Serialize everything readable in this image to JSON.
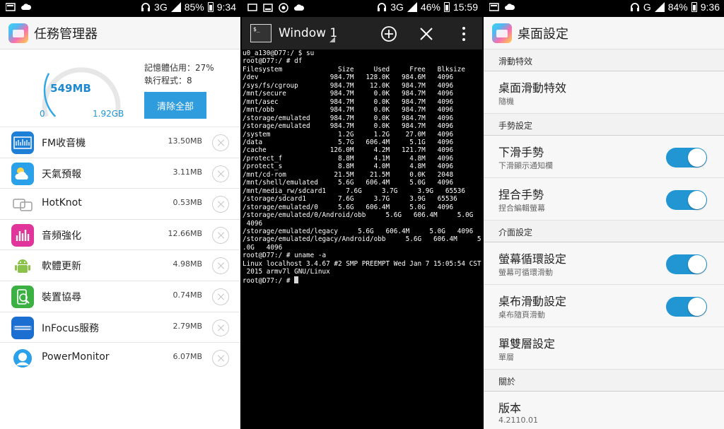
{
  "screens": {
    "task_manager": {
      "status": {
        "network": "3G",
        "battery": "85%",
        "time": "9:34"
      },
      "title": "任務管理器",
      "gauge": {
        "used": "549MB",
        "min": "0",
        "max": "1.92GB",
        "fraction": 0.27
      },
      "memory_usage": "記憶體佔用：27%",
      "running_programs": "執行程式：8",
      "clear_all_label": "清除全部",
      "apps": [
        {
          "name": "FM收音機",
          "size": "13.50MB",
          "icon": "radio-icon",
          "color": "#1e7fd6"
        },
        {
          "name": "天氣預報",
          "size": "3.11MB",
          "icon": "weather-icon",
          "color": "#2aa1e8"
        },
        {
          "name": "HotKnot",
          "size": "0.53MB",
          "icon": "hotknot-icon",
          "color": "#ffffff"
        },
        {
          "name": "音頻強化",
          "size": "12.66MB",
          "icon": "audio-enhance-icon",
          "color": "#e0359a"
        },
        {
          "name": "軟體更新",
          "size": "4.98MB",
          "icon": "android-update-icon",
          "color": "#ffffff"
        },
        {
          "name": "裝置協尋",
          "size": "0.74MB",
          "icon": "device-finder-icon",
          "color": "#3cb043"
        },
        {
          "name": "InFocus服務",
          "size": "2.79MB",
          "icon": "infocus-icon",
          "color": "#1a6fd1"
        },
        {
          "name": "PowerMonitor",
          "size": "6.07MB",
          "icon": "power-monitor-icon",
          "color": "#ffffff"
        }
      ]
    },
    "terminal": {
      "status": {
        "network": "3G",
        "battery": "46%",
        "time": "15:59"
      },
      "window_title": "Window 1",
      "lines": [
        "u0_a130@D77:/ $ su",
        "root@D77:/ # df",
        "Filesystem              Size     Used     Free   Blksize",
        "/dev                  984.7M   128.0K   984.6M   4096",
        "/sys/fs/cgroup        984.7M    12.0K   984.7M   4096",
        "/mnt/secure           984.7M     0.0K   984.7M   4096",
        "/mnt/asec             984.7M     0.0K   984.7M   4096",
        "/mnt/obb              984.7M     0.0K   984.7M   4096",
        "/storage/emulated     984.7M     0.0K   984.7M   4096",
        "/storage/emulated     984.7M     0.0K   984.7M   4096",
        "/system                 1.2G     1.2G    27.0M   4096",
        "/data                   5.7G   606.4M     5.1G   4096",
        "/cache                126.0M     4.2M   121.7M   4096",
        "/protect_f              8.8M     4.1M     4.8M   4096",
        "/protect_s              8.8M     4.0M     4.8M   4096",
        "/mnt/cd-rom            21.5M    21.5M     0.0K   2048",
        "/mnt/shell/emulated     5.6G   606.4M     5.0G   4096",
        "/mnt/media_rw/sdcard1     7.6G     3.7G     3.9G   65536",
        "/storage/sdcard1        7.6G     3.7G     3.9G   65536",
        "/storage/emulated/0     5.6G   606.4M     5.0G   4096",
        "/storage/emulated/0/Android/obb     5.6G   606.4M     5.0G",
        " 4096",
        "/storage/emulated/legacy     5.6G   606.4M     5.0G   4096",
        "/storage/emulated/legacy/Android/obb     5.6G   606.4M     5",
        ".0G   4096",
        "root@D77:/ # uname -a",
        "Linux localhost 3.4.67 #2 SMP PREEMPT Wed Jan 7 15:05:54 CST",
        " 2015 armv7l GNU/Linux",
        "root@D77:/ # "
      ]
    },
    "desktop_settings": {
      "status": {
        "network": "G",
        "battery": "84%",
        "time": "9:36"
      },
      "title": "桌面設定",
      "section_effect": "滑動特效",
      "row_effect": {
        "title": "桌面滑動特效",
        "subtitle": "隨機"
      },
      "section_gesture": "手勢設定",
      "row_swipe_down": {
        "title": "下滑手勢",
        "subtitle": "下滑顯示通知欄",
        "on": true
      },
      "row_pinch": {
        "title": "捏合手勢",
        "subtitle": "捏合編輯螢幕",
        "on": true
      },
      "section_ui": "介面設定",
      "row_loop": {
        "title": "螢幕循環設定",
        "subtitle": "螢幕可循環滑動",
        "on": true
      },
      "row_wallpaper": {
        "title": "桌布滑動設定",
        "subtitle": "桌布隨頁滑動",
        "on": true
      },
      "row_layer": {
        "title": "單雙層設定",
        "subtitle": "單層"
      },
      "section_about": "關於",
      "row_version": {
        "title": "版本",
        "subtitle": "4.2110.01"
      }
    }
  }
}
